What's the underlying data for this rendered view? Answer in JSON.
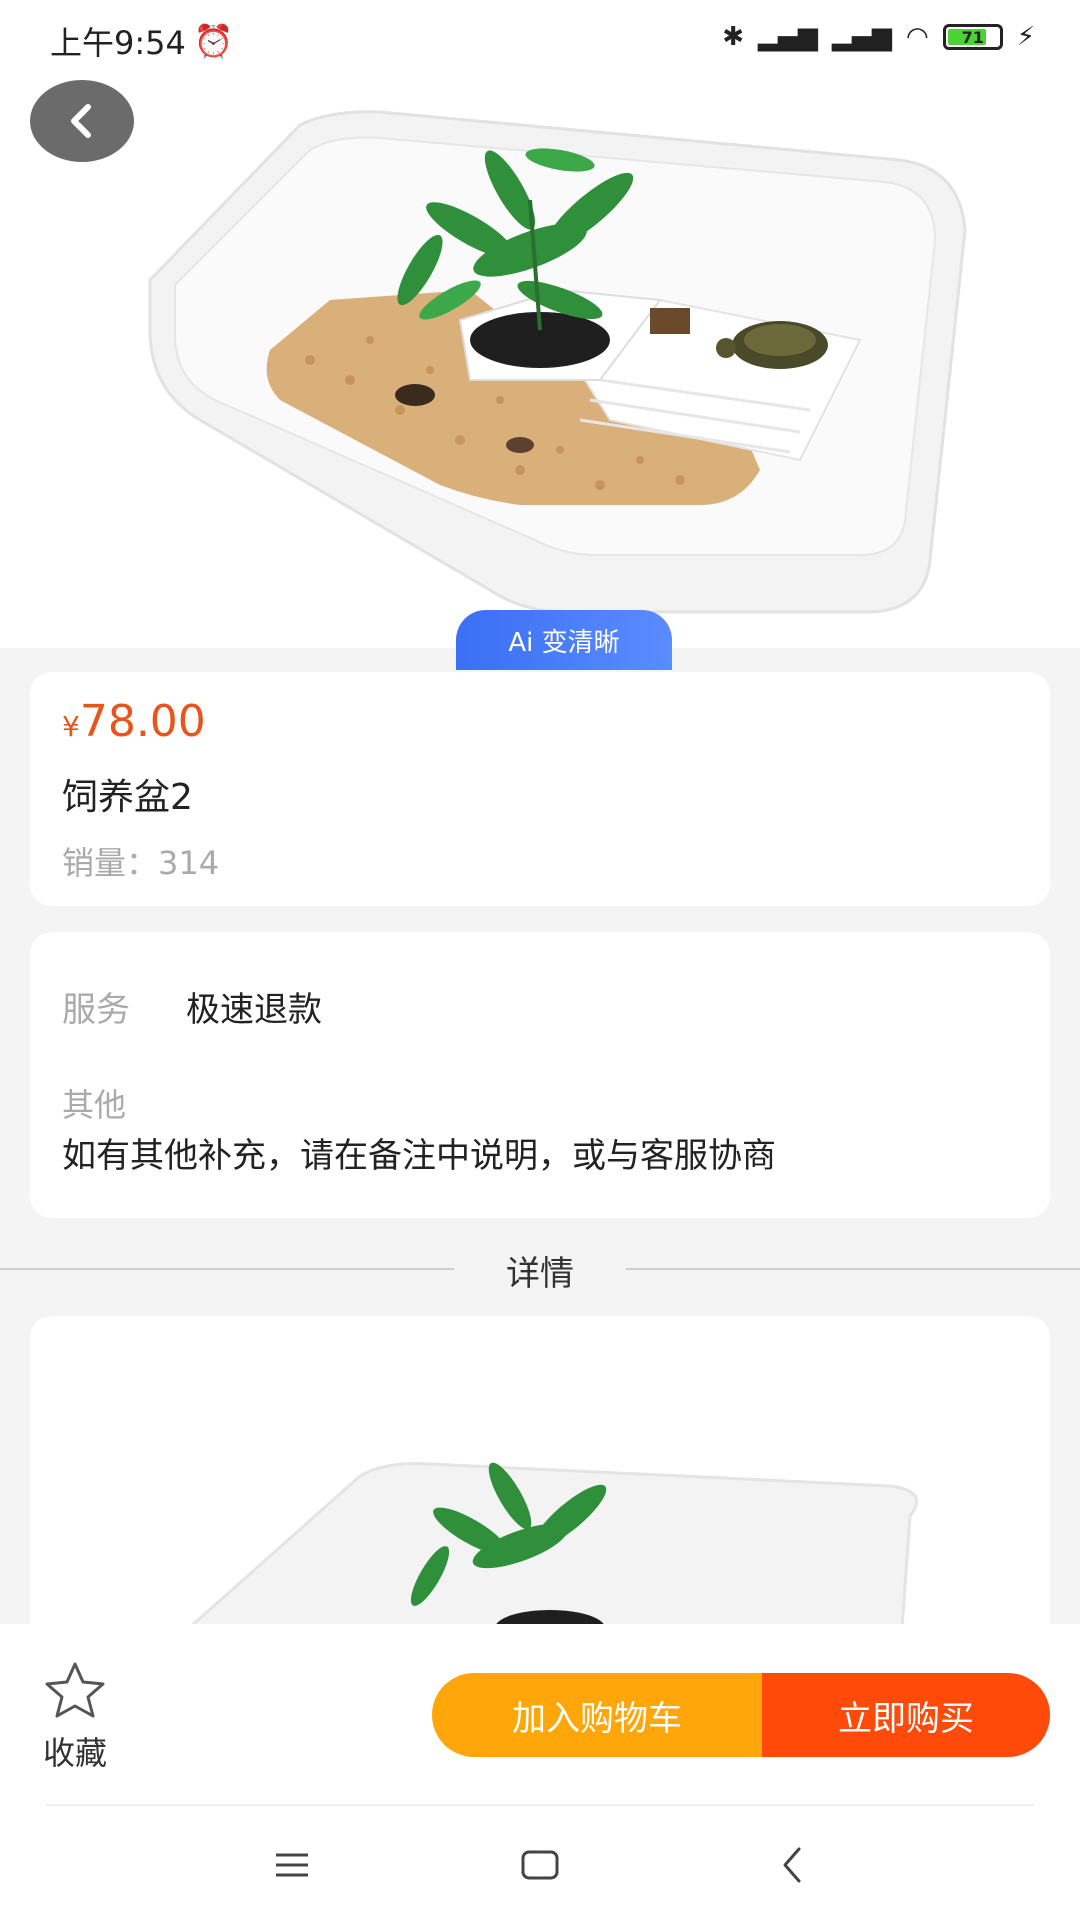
{
  "status_bar": {
    "time": "上午9:54",
    "battery_level": "71",
    "icons": [
      "alarm-icon",
      "bluetooth-icon",
      "signal-hd-icon",
      "signal-hd-icon",
      "wifi-icon",
      "battery-icon",
      "charging-icon"
    ]
  },
  "hero": {
    "ai_badge": "Ai 变清晰"
  },
  "product": {
    "currency": "¥",
    "price": "78.00",
    "name": "饲养盆2",
    "sales_label": "销量：",
    "sales_value": "314"
  },
  "service": {
    "service_label": "服务",
    "service_value": "极速退款",
    "other_label": "其他",
    "other_value": "如有其他补充，请在备注中说明，或与客服协商"
  },
  "details": {
    "heading": "详情"
  },
  "actions": {
    "favorite_label": "收藏",
    "add_to_cart": "加入购物车",
    "buy_now": "立即购买"
  },
  "colors": {
    "price": "#e8541a",
    "cart_button": "#ffa60a",
    "buy_button": "#ff4a0a",
    "ai_badge": "#3b6ff5"
  }
}
